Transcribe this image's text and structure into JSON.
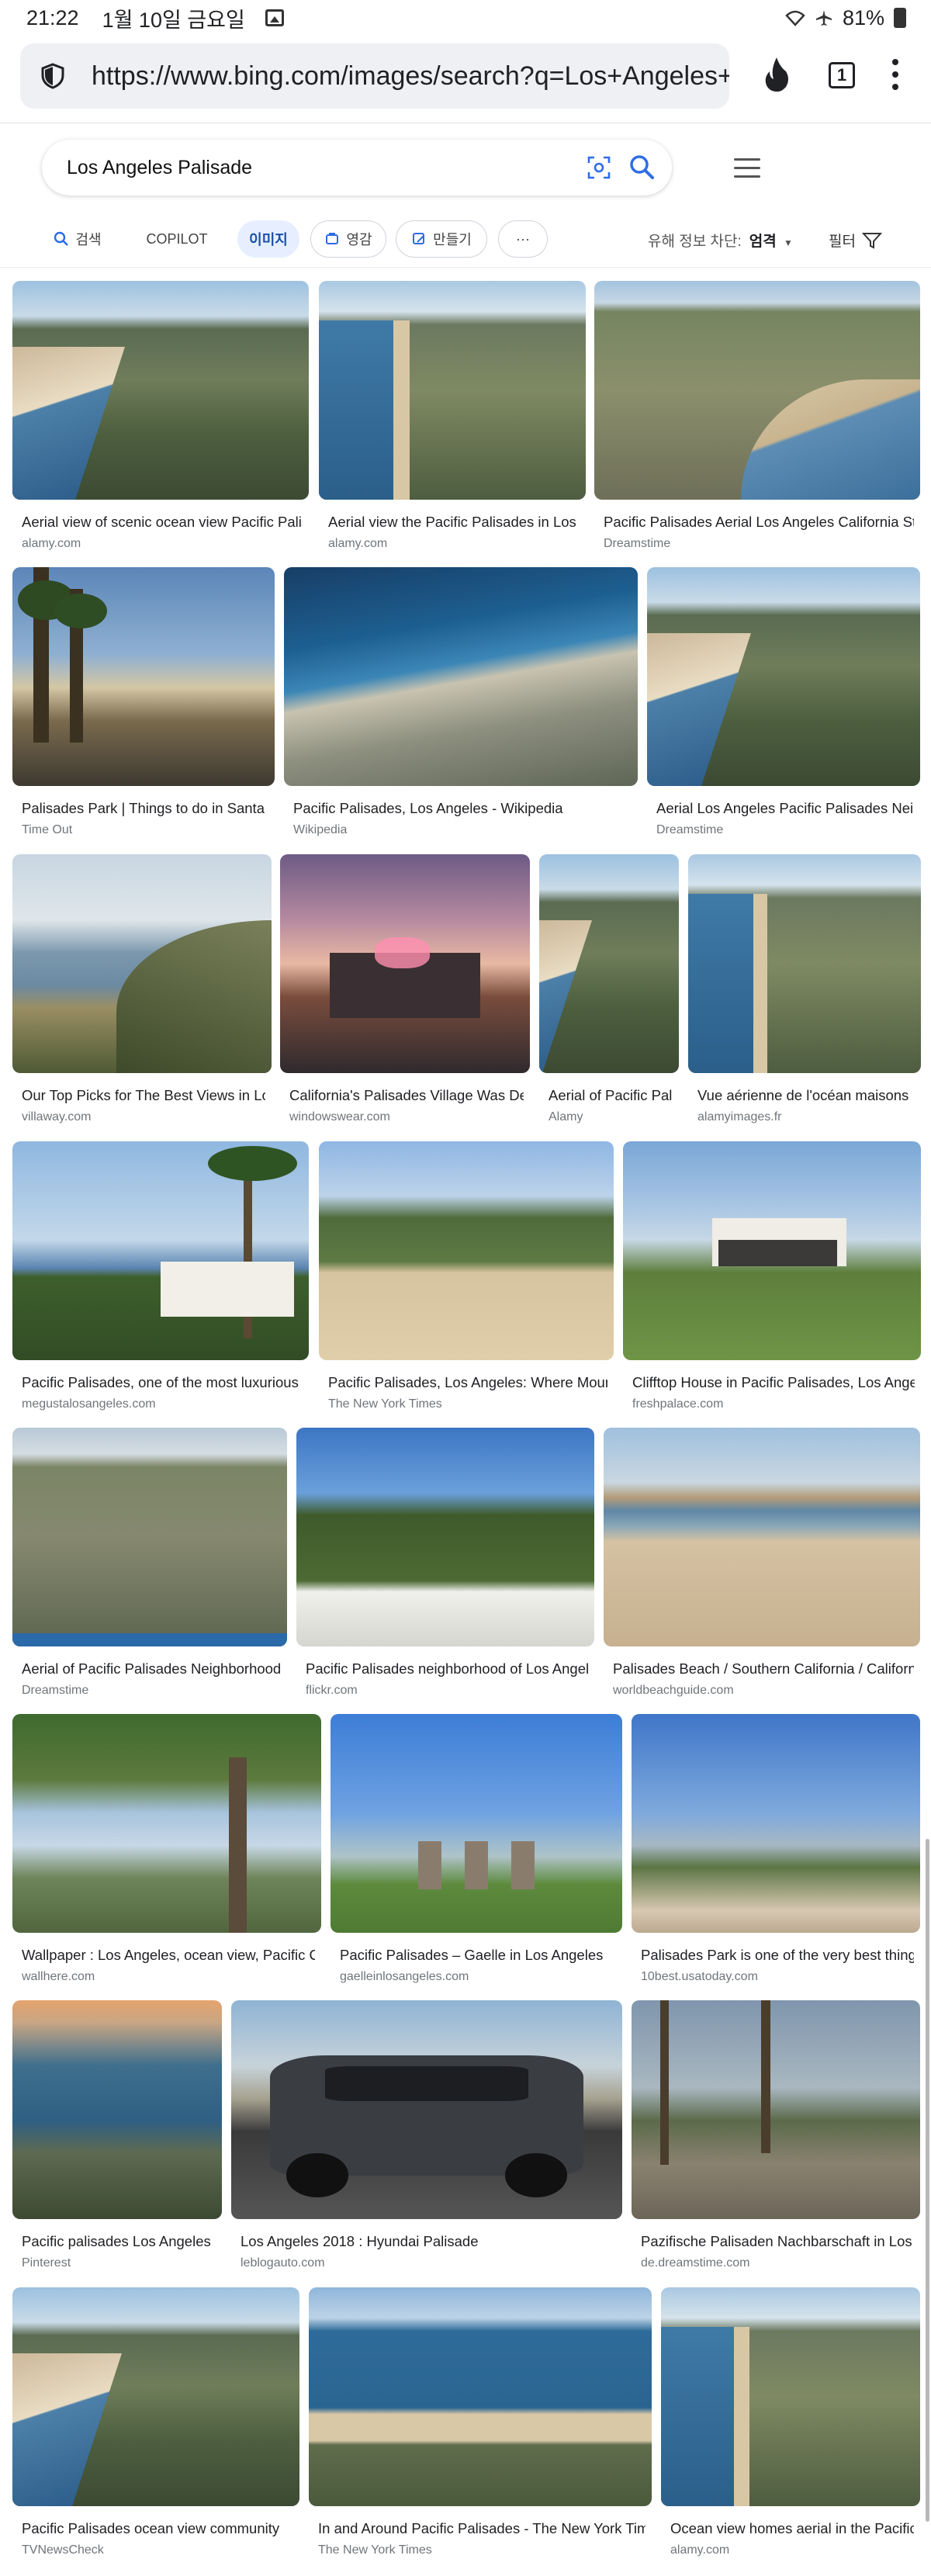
{
  "status_bar": {
    "time": "21:22",
    "date": "1월 10일 금요일",
    "battery": "81%"
  },
  "browser": {
    "url": "https://www.bing.com/images/search?q=Los+Angeles+Palisade",
    "tab_count": "1"
  },
  "search": {
    "query": "Los Angeles Palisade"
  },
  "scopes": {
    "search": "검색",
    "copilot": "COPILOT",
    "images": "이미지",
    "inspire": "영감",
    "create": "만들기",
    "more": "···"
  },
  "safe_search": {
    "label": "유해 정보 차단:",
    "value": "엄격"
  },
  "filter": {
    "label": "필터"
  },
  "results": [
    {
      "caption": "Aerial view of scenic ocean view Pacific Palisades",
      "source": "alamy.com",
      "scene": "aerial"
    },
    {
      "caption": "Aerial view the Pacific Palisades in Los Angeles",
      "source": "alamy.com",
      "scene": "aerial2"
    },
    {
      "caption": "Pacific Palisades Aerial Los Angeles California Stock",
      "source": "Dreamstime",
      "scene": "coast"
    },
    {
      "caption": "Palisades Park | Things to do in Santa Monica",
      "source": "Time Out",
      "scene": "park"
    },
    {
      "caption": "Pacific Palisades, Los Angeles - Wikipedia",
      "source": "Wikipedia",
      "scene": "wiki"
    },
    {
      "caption": "Aerial Los Angeles Pacific Palisades Neighborhood",
      "source": "Dreamstime",
      "scene": "aerial"
    },
    {
      "caption": "Our Top Picks for The Best Views in Los Angeles",
      "source": "villaway.com",
      "scene": "sunset"
    },
    {
      "caption": "California's Palisades Village Was Designed",
      "source": "windowswear.com",
      "scene": "village"
    },
    {
      "caption": "Aerial of Pacific Palisades",
      "source": "Alamy",
      "scene": "aerial"
    },
    {
      "caption": "Vue aérienne de l'océan maisons",
      "source": "alamyimages.fr",
      "scene": "aerial2"
    },
    {
      "caption": "Pacific Palisades, one of the most luxurious",
      "source": "megustalosangeles.com",
      "scene": "palms"
    },
    {
      "caption": "Pacific Palisades, Los Angeles: Where Mountains Meet",
      "source": "The New York Times",
      "scene": "beachpark"
    },
    {
      "caption": "Clifftop House in Pacific Palisades, Los Angeles",
      "source": "freshpalace.com",
      "scene": "house"
    },
    {
      "caption": "Aerial of Pacific Palisades Neighborhood",
      "source": "Dreamstime",
      "scene": "neigh"
    },
    {
      "caption": "Pacific Palisades neighborhood of Los Angeles",
      "source": "flickr.com",
      "scene": "hill"
    },
    {
      "caption": "Palisades Beach / Southern California / California",
      "source": "worldbeachguide.com",
      "scene": "sand"
    },
    {
      "caption": "Wallpaper : Los Angeles, ocean view, Pacific Coast",
      "source": "wallhere.com",
      "scene": "tree"
    },
    {
      "caption": "Pacific Palisades – Gaelle in Los Angeles",
      "source": "gaelleinlosangeles.com",
      "scene": "memorial"
    },
    {
      "caption": "Palisades Park is one of the very best things",
      "source": "10best.usatoday.com",
      "scene": "walk"
    },
    {
      "caption": "Pacific palisades Los Angeles",
      "source": "Pinterest",
      "scene": "dusk"
    },
    {
      "caption": "Los Angeles 2018 : Hyundai Palisade",
      "source": "leblogauto.com",
      "scene": "car"
    },
    {
      "caption": "Pazifische Palisaden Nachbarschaft in Los Angeles",
      "source": "de.dreamstime.com",
      "scene": "street"
    },
    {
      "caption": "Pacific Palisades ocean view community",
      "source": "TVNewsCheck",
      "scene": "aerial"
    },
    {
      "caption": "In and Around Pacific Palisades - The New York Times",
      "source": "The New York Times",
      "scene": "coast2"
    },
    {
      "caption": "Ocean view homes aerial in the Pacific Palisades",
      "source": "alamy.com",
      "scene": "aerial2"
    }
  ]
}
